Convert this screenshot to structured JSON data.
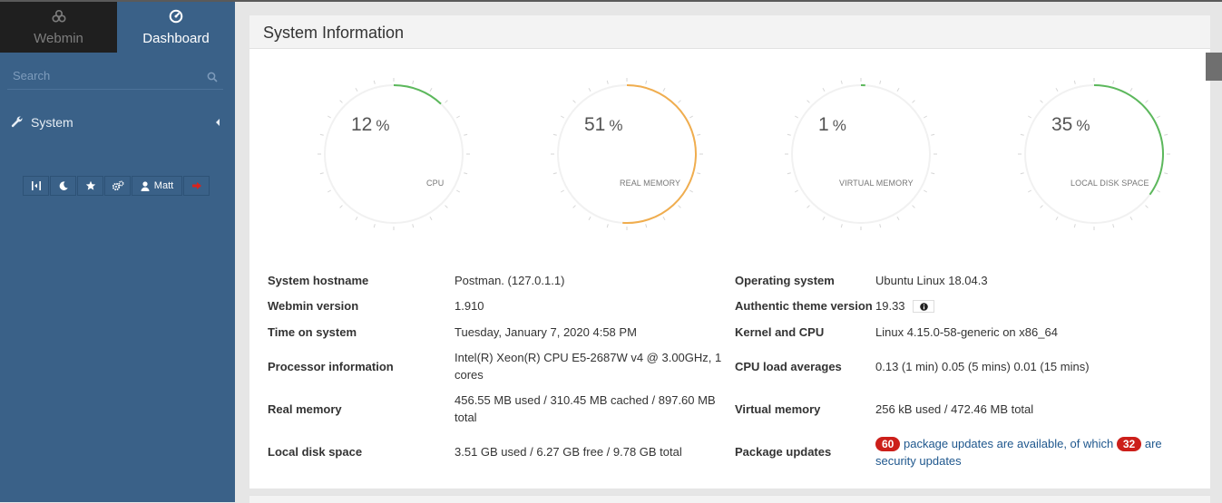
{
  "sidebar": {
    "tabs": [
      {
        "label": "Webmin",
        "icon": "webmin-logo-icon"
      },
      {
        "label": "Dashboard",
        "icon": "dashboard-icon"
      }
    ],
    "search_placeholder": "Search",
    "menu": [
      {
        "label": "System",
        "icon": "wrench-icon"
      }
    ],
    "toolbar": {
      "user_label": "Matt"
    }
  },
  "panel": {
    "title": "System Information"
  },
  "gauges": [
    {
      "value": "12",
      "unit": "%",
      "label": "CPU",
      "fraction": 0.12,
      "color": "#5cb85c"
    },
    {
      "value": "51",
      "unit": "%",
      "label": "REAL MEMORY",
      "fraction": 0.51,
      "color": "#f0ad4e"
    },
    {
      "value": "1",
      "unit": "%",
      "label": "VIRTUAL MEMORY",
      "fraction": 0.01,
      "color": "#5cb85c"
    },
    {
      "value": "35",
      "unit": "%",
      "label": "LOCAL DISK SPACE",
      "fraction": 0.35,
      "color": "#5cb85c"
    }
  ],
  "info": {
    "hostname": {
      "label": "System hostname",
      "value": "Postman. (127.0.1.1)"
    },
    "webmin_version": {
      "label": "Webmin version",
      "value": "1.910"
    },
    "time": {
      "label": "Time on system",
      "value": "Tuesday, January 7, 2020 4:58 PM"
    },
    "processor": {
      "label": "Processor information",
      "value_line1": "Intel(R) Xeon(R) CPU E5-2687W v4 @ 3.00GHz, 1",
      "value_line2": "cores"
    },
    "real_memory": {
      "label": "Real memory",
      "value_line1": "456.55 MB used / 310.45 MB cached / 897.60 MB",
      "value_line2": "total"
    },
    "disk": {
      "label": "Local disk space",
      "value": "3.51 GB used / 6.27 GB free / 9.78 GB total"
    },
    "os": {
      "label": "Operating system",
      "value": "Ubuntu Linux 18.04.3"
    },
    "theme": {
      "label": "Authentic theme version",
      "value": "19.33"
    },
    "kernel": {
      "label": "Kernel and CPU",
      "value": "Linux 4.15.0-58-generic on x86_64"
    },
    "load": {
      "label": "CPU load averages",
      "value": "0.13 (1 min) 0.05 (5 mins) 0.01 (15 mins)"
    },
    "virtual_memory": {
      "label": "Virtual memory",
      "value": "256 kB used / 472.46 MB total"
    },
    "packages": {
      "label": "Package updates",
      "count": "60",
      "text1": "package updates are available, of which",
      "security_count": "32",
      "text2": "are",
      "text3": "security updates"
    }
  },
  "colors": {
    "sidebar_bg": "#3a6188",
    "badge": "#cc1f1a",
    "link": "#20588e"
  }
}
